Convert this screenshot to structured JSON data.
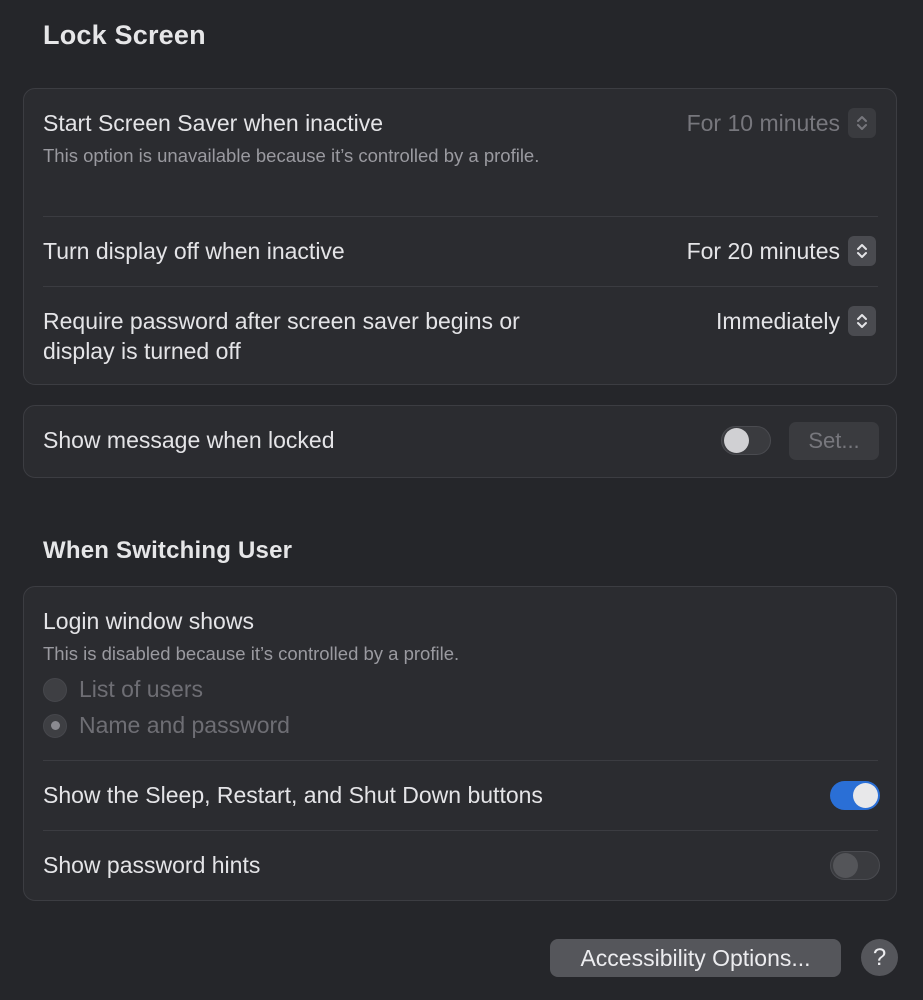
{
  "lock_screen": {
    "title": "Lock Screen",
    "screen_saver": {
      "label": "Start Screen Saver when inactive",
      "note": "This option is unavailable because it’s controlled by a profile.",
      "value": "For 10 minutes",
      "disabled": true
    },
    "display_off": {
      "label": "Turn display off when inactive",
      "value": "For 20 minutes"
    },
    "require_password": {
      "label_line1": "Require password after screen saver begins or",
      "label_line2": "display is turned off",
      "value": "Immediately"
    },
    "show_message": {
      "label": "Show message when locked",
      "enabled": false,
      "set_button": "Set..."
    }
  },
  "switching_user": {
    "title": "When Switching User",
    "login_window": {
      "label": "Login window shows",
      "note": "This is disabled because it’s controlled by a profile.",
      "options": [
        {
          "label": "List of users",
          "selected": false
        },
        {
          "label": "Name and password",
          "selected": true
        }
      ]
    },
    "sleep_restart": {
      "label": "Show the Sleep, Restart, and Shut Down buttons",
      "enabled": true
    },
    "password_hints": {
      "label": "Show password hints",
      "enabled": false
    }
  },
  "footer": {
    "accessibility_button": "Accessibility Options...",
    "help_button": "?"
  },
  "colors": {
    "accent": "#2a6fd6",
    "background": "#25262a",
    "group_background": "#2b2c30"
  }
}
